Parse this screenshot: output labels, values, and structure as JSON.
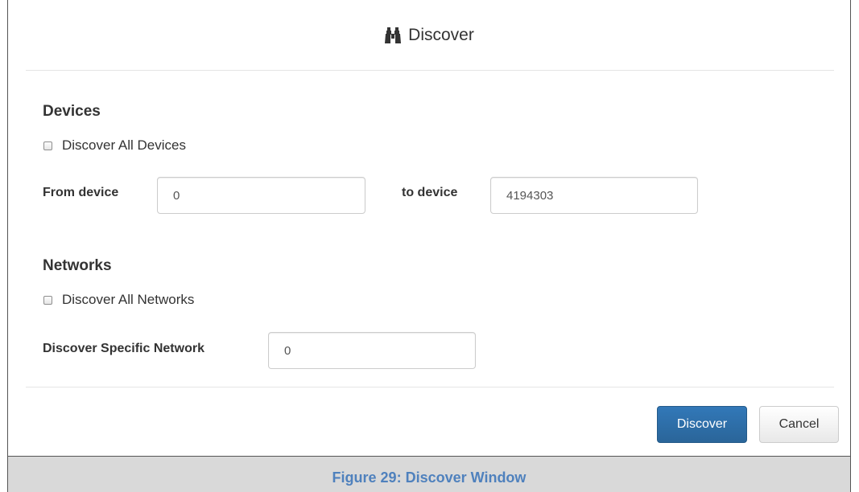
{
  "modal": {
    "title": "Discover",
    "title_icon": "binoculars-icon"
  },
  "devices": {
    "heading": "Devices",
    "discover_all_label": "Discover All Devices",
    "discover_all_checked": false,
    "from_label": "From device",
    "from_value": "0",
    "to_label": "to device",
    "to_value": "4194303"
  },
  "networks": {
    "heading": "Networks",
    "discover_all_label": "Discover All Networks",
    "discover_all_checked": false,
    "specific_label": "Discover Specific Network",
    "specific_value": "0"
  },
  "footer": {
    "discover_label": "Discover",
    "cancel_label": "Cancel"
  },
  "caption": "Figure 29: Discover Window",
  "colors": {
    "primary_button": "#2a6599",
    "caption_text": "#4f81bd",
    "caption_bg": "#d9d9d9"
  }
}
